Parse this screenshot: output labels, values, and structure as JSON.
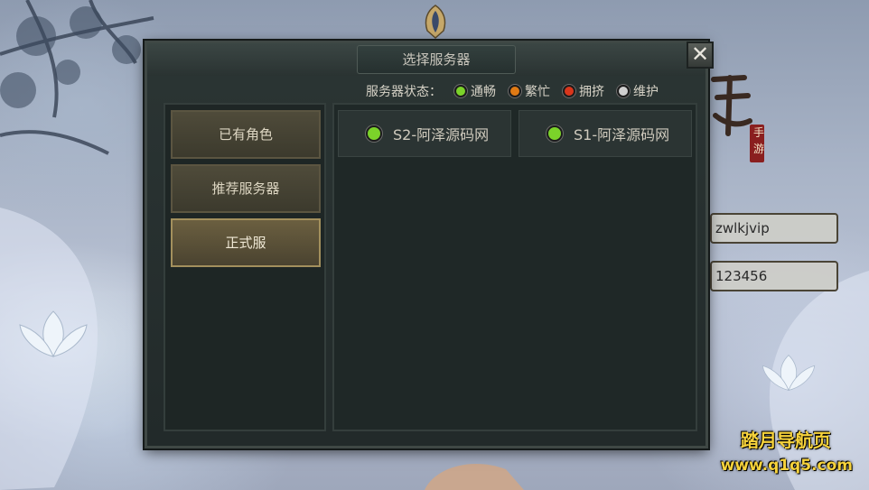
{
  "dialog": {
    "title": "选择服务器",
    "close_label": "✕",
    "status_label": "服务器状态：",
    "statuses": [
      {
        "label": "通畅",
        "color": "#7bd22a"
      },
      {
        "label": "繁忙",
        "color": "#e07a14"
      },
      {
        "label": "拥挤",
        "color": "#d9361c"
      },
      {
        "label": "维护",
        "color": "#cfcfcf"
      }
    ],
    "categories": [
      {
        "label": "已有角色",
        "active": false
      },
      {
        "label": "推荐服务器",
        "active": false
      },
      {
        "label": "正式服",
        "active": true
      }
    ],
    "servers": [
      {
        "name": "S2-阿泽源码网",
        "status_color": "#7bd22a"
      },
      {
        "name": "S1-阿泽源码网",
        "status_color": "#7bd22a"
      }
    ]
  },
  "login": {
    "username": "zwlkjvip",
    "password": "123456"
  },
  "title_art_chars": [
    "手",
    "游"
  ],
  "watermark": {
    "line1": "踏月导航页",
    "line2": "www.q1q5.com"
  }
}
